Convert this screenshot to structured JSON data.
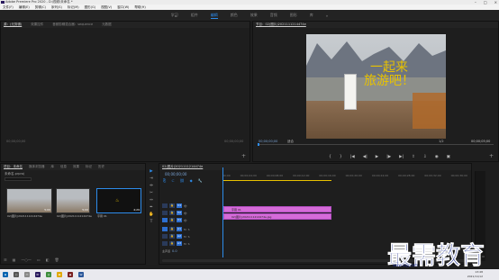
{
  "window": {
    "title": "Adobe Premiere Pro 2020 - D:\\视频\\未命名 *"
  },
  "menu": [
    "文件(F)",
    "编辑(E)",
    "剪辑(C)",
    "序列(S)",
    "标记(M)",
    "图形(G)",
    "视图(V)",
    "窗口(W)",
    "帮助(H)"
  ],
  "workspaces": [
    "学习",
    "组件",
    "编辑",
    "颜色",
    "效果",
    "音频",
    "图形",
    "库"
  ],
  "active_workspace": 2,
  "source_panel": {
    "tabs": [
      "源：(无剪辑)",
      "效果控件",
      "音频剪辑混合器：sequence",
      "元数据"
    ],
    "tc_left": "00;00;00;00",
    "tc_right": "00;00;00;00"
  },
  "program_panel": {
    "tab": "节目：02(图片)2021111214474e",
    "tc_left": "00;00;00;00",
    "fit": "适合",
    "page": "1/2",
    "tc_right": "00;00;05;00",
    "overlay_line1": "一起来",
    "overlay_line2": "旅游吧！"
  },
  "project_panel": {
    "tabs": [
      "项目：未命名",
      "媒体浏览器",
      "库",
      "信息",
      "效果",
      "标记",
      "历史"
    ],
    "path": "未命名.prproj",
    "items": [
      {
        "name": "02(图片)2021111214474e",
        "dur": "5;00"
      },
      {
        "name": "02(图片)2021111214474e",
        "dur": "5;00"
      },
      {
        "name": "字幕 01",
        "dur": "4;29"
      }
    ]
  },
  "timeline": {
    "tab": "02(图片)2021111214474e",
    "tc": "00;00;00;00",
    "ticks": [
      "00;00",
      "00;00;04;00",
      "00;00;08;00",
      "00;00;12;00",
      "00;00;16;00",
      "00;00;20;00",
      "00;00;24;00",
      "00;00;28;00",
      "00;00;32;00",
      "00;00;36;00"
    ],
    "tracks": [
      "V3",
      "V2",
      "V1",
      "A1",
      "A2",
      "A3",
      "主声道"
    ],
    "clip_title": "字幕 01",
    "clip_image": "02(图片)2021111214474e.jpg",
    "master_value": "0.0"
  },
  "tray": {
    "time": "13:48",
    "date": "2021/11/12"
  },
  "watermark": {
    "text": "最需教育",
    "url": "www.zxjy.com"
  },
  "colors": {
    "accent": "#2d8ceb",
    "clip": "#d56bd8",
    "overlay": "#e8c200"
  }
}
